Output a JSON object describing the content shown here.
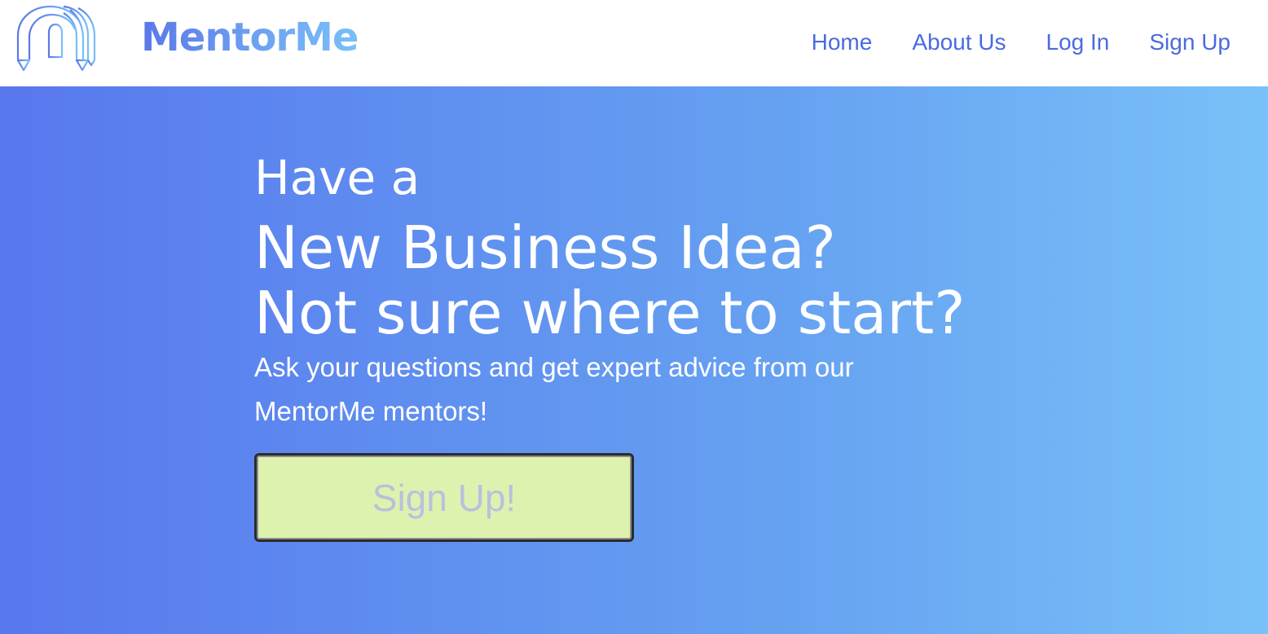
{
  "header": {
    "brand": "MentorMe",
    "logo_icon": "mentorme-arch-pencils-logo",
    "nav": [
      {
        "label": "Home"
      },
      {
        "label": "About Us"
      },
      {
        "label": "Log In"
      },
      {
        "label": "Sign Up"
      }
    ]
  },
  "hero": {
    "eyebrow": "Have a",
    "headline_line1": "New Business Idea?",
    "headline_line2": "Not sure where to start?",
    "subtext": "Ask your questions and get expert advice from our MentorMe mentors!",
    "cta_label": "Sign Up!"
  },
  "colors": {
    "brand_blue": "#4a6ae0",
    "gradient_start": "#5878ee",
    "gradient_end": "#79c1f8",
    "cta_background": "#def2b0"
  }
}
